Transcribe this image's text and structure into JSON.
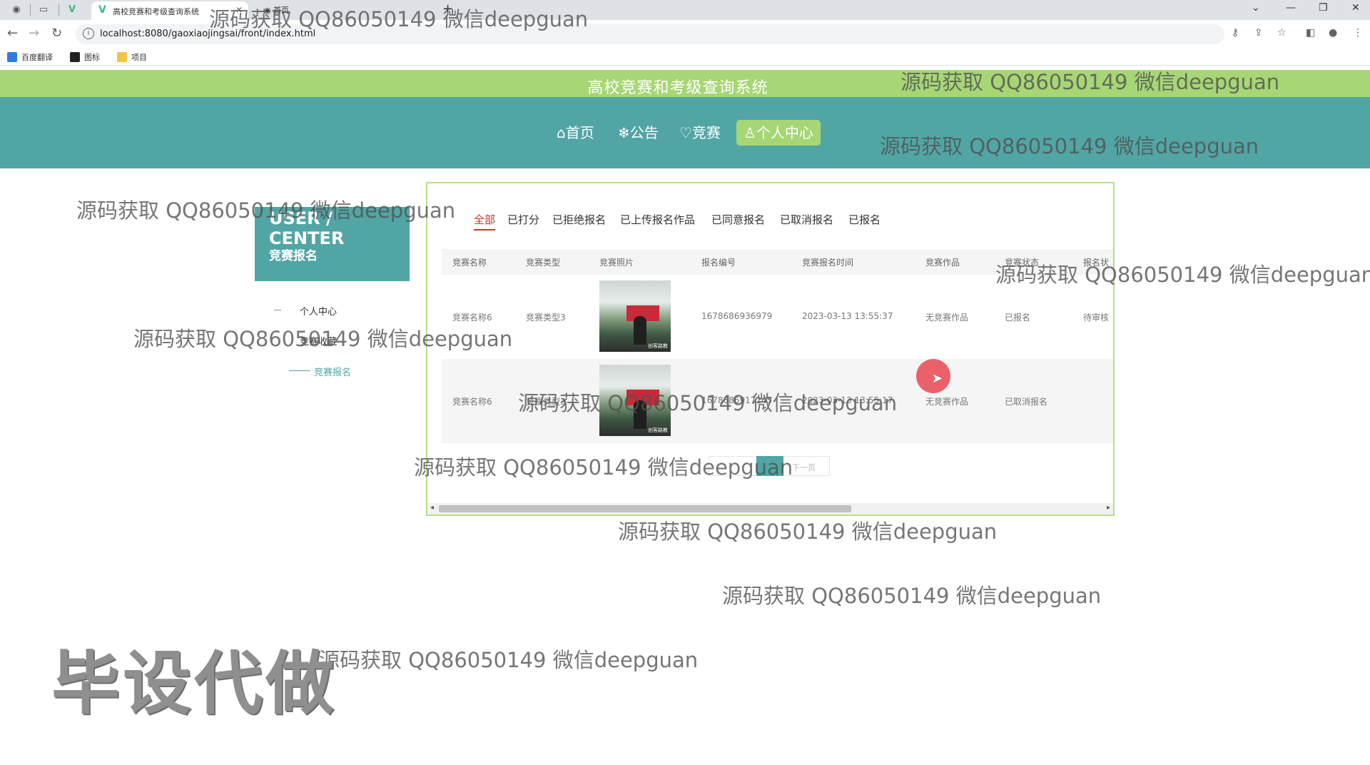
{
  "browser": {
    "active_tab_title": "高校竞赛和考级查询系统",
    "second_tab_title": "首页",
    "url": "localhost:8080/gaoxiaojingsai/front/index.html",
    "bookmarks": [
      "百度翻译",
      "图标",
      "项目"
    ]
  },
  "site": {
    "title": "高校竞赛和考级查询系统",
    "nav": [
      {
        "label": "⌂首页"
      },
      {
        "label": "❄公告"
      },
      {
        "label": "♡竞赛"
      },
      {
        "label": "♙个人中心"
      }
    ]
  },
  "sidebar": {
    "title": "USER / CENTER",
    "subtitle": "竞赛报名",
    "items": [
      "个人中心",
      "竞赛收藏",
      "竞赛报名"
    ]
  },
  "filter_tabs": [
    "全部",
    "已打分",
    "已拒绝报名",
    "已上传报名作品",
    "已同意报名",
    "已取消报名",
    "已报名"
  ],
  "table": {
    "headers": [
      "竞赛名称",
      "竞赛类型",
      "竞赛照片",
      "报名编号",
      "竞赛报名时间",
      "竞赛作品",
      "竞赛状态",
      "报名状"
    ],
    "rows": [
      {
        "name": "竞赛名称6",
        "type": "竞赛类型3",
        "photo_caption": "创客路教",
        "number": "1678686936979",
        "time": "2023-03-13 13:55:37",
        "work": "无竞赛作品",
        "status": "已报名",
        "reg_status": "待审核"
      },
      {
        "name": "竞赛名称6",
        "type": "竞赛类型3",
        "photo_caption": "创客路教",
        "number": "1678686917245",
        "time": "2023-03-13 13:55:17",
        "work": "无竞赛作品",
        "status": "已取消报名",
        "reg_status": ""
      }
    ]
  },
  "pager": {
    "next": "下一页"
  },
  "watermarks": {
    "text": "源码获取 QQ86050149 微信deepguan",
    "big": "毕设代做"
  }
}
